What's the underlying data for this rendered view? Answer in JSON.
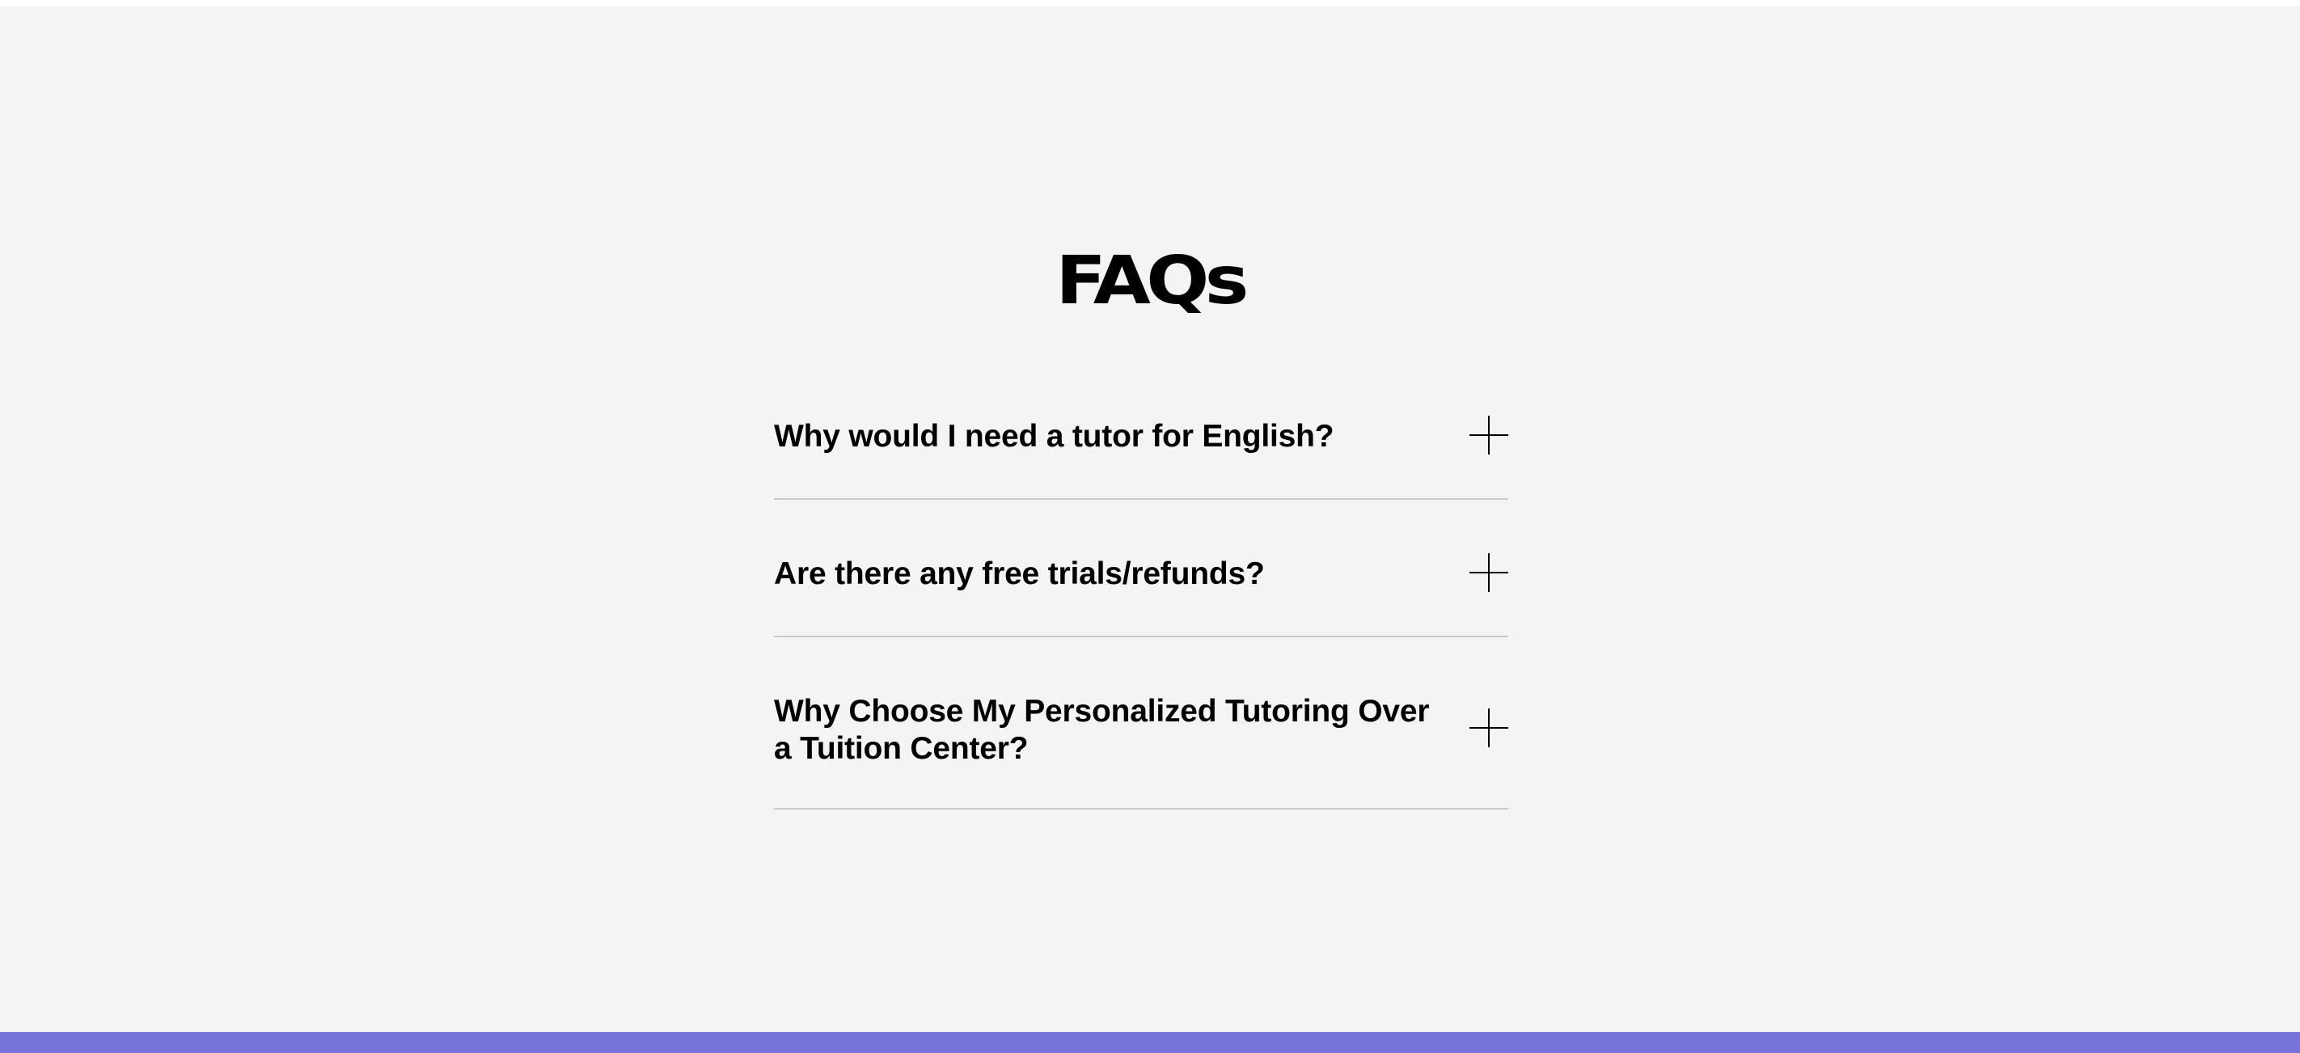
{
  "page": {
    "title": "FAQs",
    "colors": {
      "section_background": "#f4f4f2",
      "footer_band": "#7873d9",
      "divider": "#c9c9c7",
      "text": "#000000"
    }
  },
  "faqs": [
    {
      "question": "Why would I need a tutor for English?",
      "icon": "plus-icon"
    },
    {
      "question": "Are there any free trials/refunds?",
      "icon": "plus-icon"
    },
    {
      "question": "Why Choose My Personalized Tutoring Over a Tuition Center?",
      "icon": "plus-icon"
    }
  ]
}
